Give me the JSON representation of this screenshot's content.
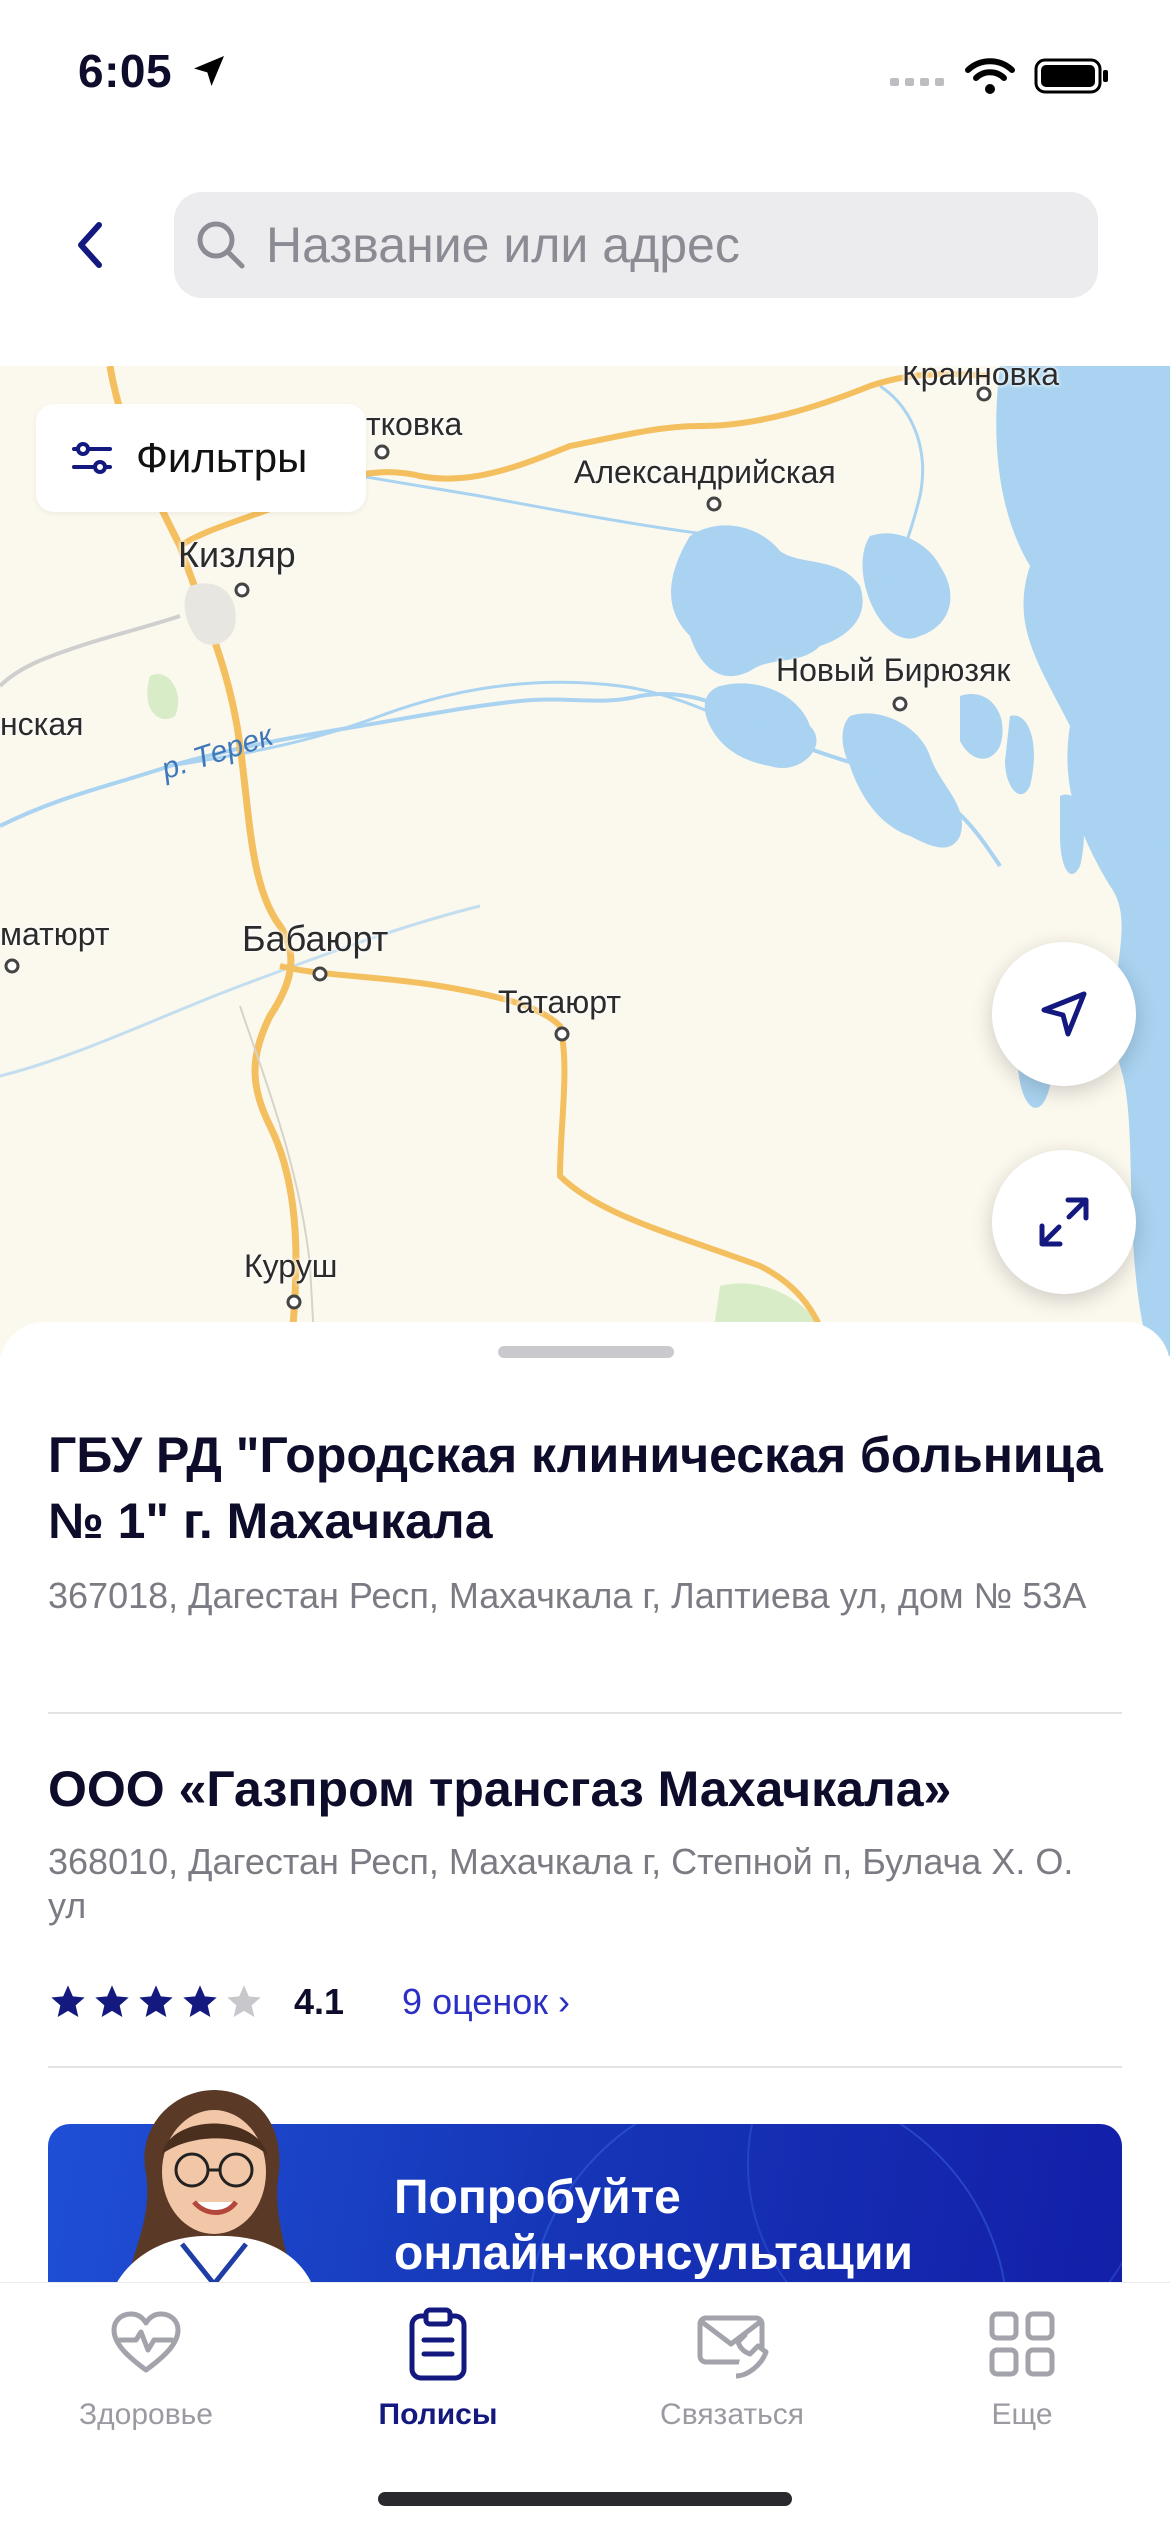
{
  "status_bar": {
    "time": "6:05"
  },
  "search": {
    "placeholder": "Название или адрес"
  },
  "map": {
    "filters_label": "Фильтры",
    "places": [
      "Крайновка",
      "тковка",
      "Александрийская",
      "Кизляр",
      "Новый Бирюзяк",
      "нская",
      "матюрт",
      "Бабаюрт",
      "Татаюрт",
      "Куруш"
    ],
    "river": "р. Терек"
  },
  "results": [
    {
      "title": "ГБУ РД \"Городская клиническая больница № 1\" г. Махачкала",
      "address": "367018, Дагестан Респ, Махачкала г, Лаптиева ул, дом № 53А"
    },
    {
      "title": "ООО «Газпром трансгаз Махачкала»",
      "address": "368010, Дагестан Респ, Махачкала г, Степной п, Булача Х. О. ул",
      "rating": 4.1,
      "rating_text": "4.1",
      "reviews_link": "9 оценок ›"
    }
  ],
  "banner": {
    "line1": "Попробуйте",
    "line2": "онлайн-консультации"
  },
  "tabs": [
    {
      "label": "Здоровье",
      "icon": "heart-pulse-icon",
      "active": false
    },
    {
      "label": "Полисы",
      "icon": "clipboard-icon",
      "active": true
    },
    {
      "label": "Связаться",
      "icon": "phone-envelope-icon",
      "active": false
    },
    {
      "label": "Еще",
      "icon": "grid-icon",
      "active": false
    }
  ],
  "colors": {
    "accent": "#13197f",
    "link": "#2c2fc4",
    "water": "#a9d3f0",
    "road": "#f4bf5f",
    "land": "#fbf8ee",
    "banner": "#1637b8"
  }
}
